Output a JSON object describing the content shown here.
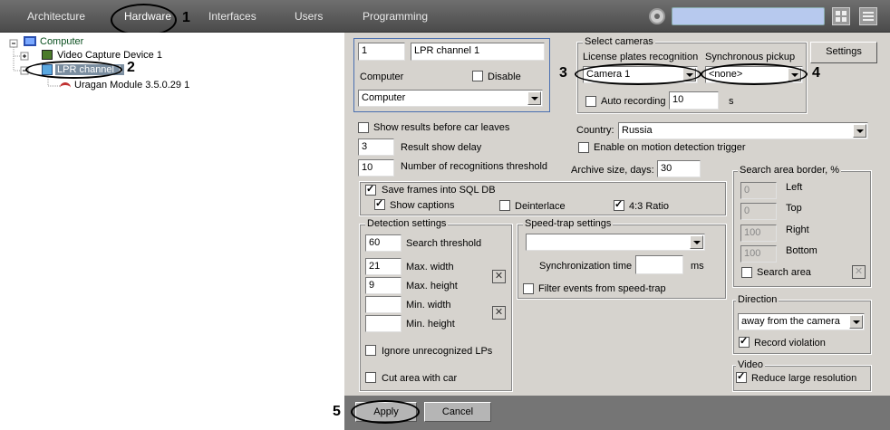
{
  "topbar": {
    "tabs": [
      "Architecture",
      "Hardware",
      "Interfaces",
      "Users",
      "Programming"
    ]
  },
  "tree": {
    "root": "Computer",
    "device": "Video Capture Device 1",
    "channel": "LPR channel 1",
    "module": "Uragan Module 3.5.0.29 1"
  },
  "form": {
    "id": "1",
    "name": "LPR channel 1",
    "computer_label": "Computer",
    "disable_label": "Disable",
    "computer_value": "Computer",
    "select_cameras_title": "Select cameras",
    "lpr_label": "License plates recognition",
    "sync_label": "Synchronous pickup",
    "camera_value": "Camera 1",
    "sync_value": "<none>",
    "auto_recording_label": "Auto recording",
    "auto_recording_value": "10",
    "seconds_unit": "s",
    "settings_button": "Settings",
    "show_results_label": "Show results before car leaves",
    "result_delay_value": "3",
    "result_delay_label": "Result show delay",
    "num_threshold_value": "10",
    "num_threshold_label": "Number of recognitions threshold",
    "country_label": "Country:",
    "country_value": "Russia",
    "motion_trigger_label": "Enable on motion detection trigger",
    "archive_label": "Archive size, days:",
    "archive_value": "30",
    "save_frames_label": "Save frames into SQL DB",
    "show_captions_label": "Show captions",
    "deinterlace_label": "Deinterlace",
    "ratio_label": "4:3 Ratio",
    "detection_title": "Detection settings",
    "search_threshold_value": "60",
    "search_threshold_label": "Search threshold",
    "max_width_value": "21",
    "max_width_label": "Max. width",
    "max_height_value": "9",
    "max_height_label": "Max. height",
    "min_width_label": "Min. width",
    "min_height_label": "Min. height",
    "ignore_label": "Ignore unrecognized LPs",
    "cut_area_label": "Cut area with car",
    "speedtrap_title": "Speed-trap settings",
    "sync_time_label": "Synchronization time",
    "ms_unit": "ms",
    "filter_label": "Filter events from speed-trap",
    "search_area_title": "Search area border, %",
    "left_value": "0",
    "left_label": "Left",
    "top_value": "0",
    "top_label": "Top",
    "right_value": "100",
    "right_label": "Right",
    "bottom_value": "100",
    "bottom_label": "Bottom",
    "search_area_label": "Search area",
    "direction_title": "Direction",
    "direction_value": "away from the camera",
    "record_violation_label": "Record violation",
    "video_title": "Video",
    "reduce_label": "Reduce large resolution",
    "apply_button": "Apply",
    "cancel_button": "Cancel"
  },
  "annotations": [
    "1",
    "2",
    "3",
    "4",
    "5"
  ]
}
